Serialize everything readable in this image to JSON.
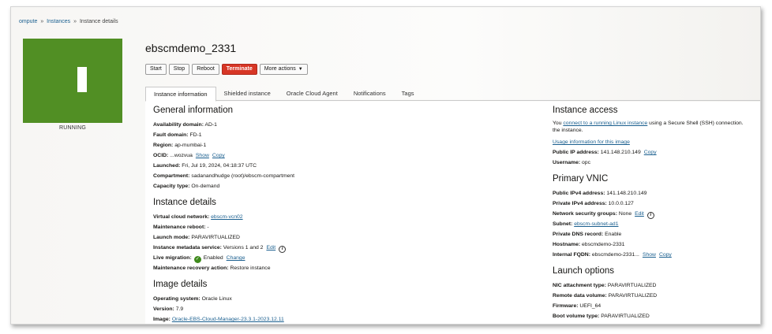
{
  "breadcrumb": {
    "item1": "ompute",
    "item2": "Instances",
    "current": "Instance details",
    "sep": "»"
  },
  "status": {
    "label": "RUNNING",
    "color": "#518f24"
  },
  "instance": {
    "name": "ebscmdemo_2331"
  },
  "actions": {
    "start": "Start",
    "stop": "Stop",
    "reboot": "Reboot",
    "terminate": "Terminate",
    "more": "More actions",
    "more_caret": "▼"
  },
  "tabs": [
    {
      "label": "Instance information"
    },
    {
      "label": "Shielded instance"
    },
    {
      "label": "Oracle Cloud Agent"
    },
    {
      "label": "Notifications"
    },
    {
      "label": "Tags"
    }
  ],
  "general": {
    "heading": "General information",
    "availability_label": "Availability domain:",
    "availability_value": "AD-1",
    "fault_label": "Fault domain:",
    "fault_value": "FD-1",
    "region_label": "Region:",
    "region_value": "ap-mumbai-1",
    "ocid_label": "OCID:",
    "ocid_value": "...wozvua",
    "ocid_show": "Show",
    "ocid_copy": "Copy",
    "launched_label": "Launched:",
    "launched_value": "Fri, Jul 19, 2024, 04:18:37 UTC",
    "compartment_label": "Compartment:",
    "compartment_value": "sadanandhudge (root)/ebscm-compartment",
    "capacity_label": "Capacity type:",
    "capacity_value": "On-demand"
  },
  "details": {
    "heading": "Instance details",
    "vcn_label": "Virtual cloud network:",
    "vcn_value": "ebscm-vcn02",
    "reboot_label": "Maintenance reboot:",
    "reboot_value": "-",
    "launch_mode_label": "Launch mode:",
    "launch_mode_value": "PARAVIRTUALIZED",
    "metadata_label": "Instance metadata service:",
    "metadata_value": "Versions 1 and 2",
    "metadata_edit": "Edit",
    "migration_label": "Live migration:",
    "migration_value": "Enabled",
    "migration_change": "Change",
    "recovery_label": "Maintenance recovery action:",
    "recovery_value": "Restore instance"
  },
  "image": {
    "heading": "Image details",
    "os_label": "Operating system:",
    "os_value": "Oracle Linux",
    "version_label": "Version:",
    "version_value": "7.9",
    "image_label": "Image:",
    "image_value": "Oracle-EBS-Cloud-Manager-23.3.1-2023.12.11"
  },
  "access": {
    "heading": "Instance access",
    "text_pre": "You ",
    "text_link": "connect to a running Linux instance",
    "text_post": " using a Secure Shell (SSH) connection. ",
    "text_line2": "the instance.",
    "usage_link": "Usage information for this image",
    "public_ip_label": "Public IP address:",
    "public_ip_value": "141.148.210.149",
    "public_ip_copy": "Copy",
    "username_label": "Username:",
    "username_value": "opc"
  },
  "vnic": {
    "heading": "Primary VNIC",
    "pub_ipv4_label": "Public IPv4 address:",
    "pub_ipv4_value": "141.148.210.149",
    "priv_ipv4_label": "Private IPv4 address:",
    "priv_ipv4_value": "10.0.0.127",
    "nsg_label": "Network security groups:",
    "nsg_value": "None",
    "nsg_edit": "Edit",
    "subnet_label": "Subnet:",
    "subnet_value": "ebscm-subnet-ad1",
    "dns_label": "Private DNS record:",
    "dns_value": "Enable",
    "hostname_label": "Hostname:",
    "hostname_value": "ebscmdemo-2331",
    "fqdn_label": "Internal FQDN:",
    "fqdn_value": "ebscmdemo-2331...",
    "fqdn_show": "Show",
    "fqdn_copy": "Copy"
  },
  "launch": {
    "heading": "Launch options",
    "nic_label": "NIC attachment type:",
    "nic_value": "PARAVIRTUALIZED",
    "remote_label": "Remote data volume:",
    "remote_value": "PARAVIRTUALIZED",
    "firmware_label": "Firmware:",
    "firmware_value": "UEFI_64",
    "boot_label": "Boot volume type:",
    "boot_value": "PARAVIRTUALIZED"
  },
  "icons": {
    "info": "i",
    "check": "✓"
  }
}
